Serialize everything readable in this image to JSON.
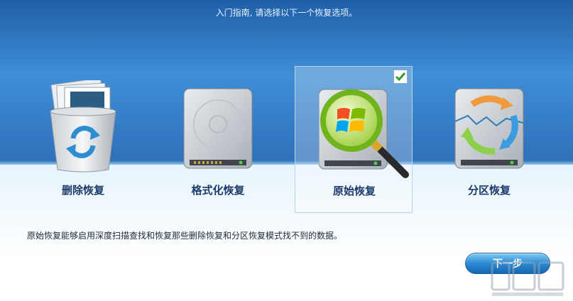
{
  "header": {
    "instruction": "入门指南, 请选择以下一个恢复选项。"
  },
  "options": [
    {
      "label": "删除恢复",
      "icon": "recycle-bin-icon",
      "selected": false
    },
    {
      "label": "格式化恢复",
      "icon": "hard-drive-icon",
      "selected": false
    },
    {
      "label": "原始恢复",
      "icon": "magnifier-windows-icon",
      "selected": true
    },
    {
      "label": "分区恢复",
      "icon": "partition-drive-icon",
      "selected": false
    }
  ],
  "description": "原始恢复能够启用深度扫描查找和恢复那些删除恢复和分区恢复模式找不到的数据。",
  "next_button": {
    "label": "下一步"
  },
  "colors": {
    "accent": "#2b8ad4",
    "top_band": "#3f8ed6",
    "label_text": "#1c3b6a",
    "check_green": "#2f9e2f"
  }
}
